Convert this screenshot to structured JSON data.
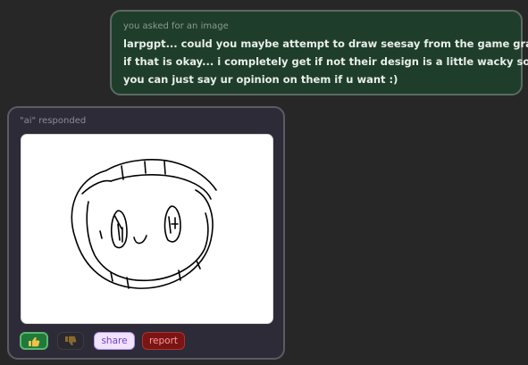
{
  "user_message": {
    "caption": "you asked for an image",
    "lines": [
      "larpgpt... could you maybe attempt to draw seesay from the game grace",
      "if that is okay... i completely get if not their design is a little wacky so",
      "you can just say ur opinion on them if u want :)"
    ]
  },
  "ai_message": {
    "caption": "\"ai\" responded",
    "image_description_icon": "drawing-canvas"
  },
  "actions": {
    "like_icon": "thumbs-up-icon",
    "dislike_icon": "thumbs-down-icon",
    "share_label": "share",
    "report_label": "report"
  },
  "colors": {
    "background": "#272727",
    "user_bubble": "#1f3d2b",
    "ai_card": "#2e2b38",
    "like_active": "#1f7a3a",
    "share": "#efe3ff",
    "report": "#7a1515"
  }
}
